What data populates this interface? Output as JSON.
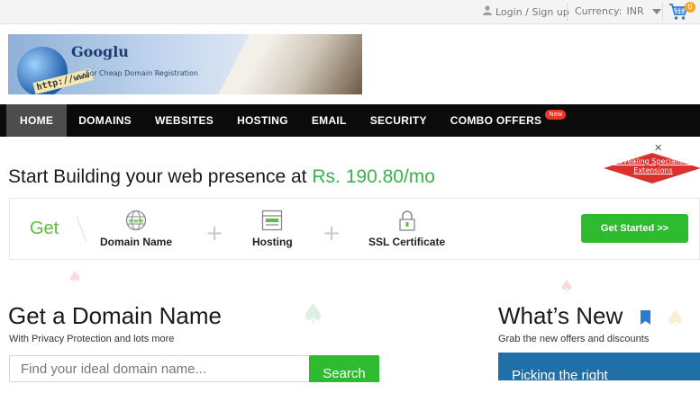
{
  "topbar": {
    "login_label": "Login / Sign up",
    "currency_label": "Currency:",
    "currency_value": "INR",
    "cart_count": "0"
  },
  "banner": {
    "brand": "Googlu",
    "tagline": "For Cheap Domain Registration",
    "url_text": "http://www"
  },
  "nav": {
    "items": [
      {
        "label": "HOME",
        "active": true
      },
      {
        "label": "DOMAINS"
      },
      {
        "label": "WEBSITES"
      },
      {
        "label": "HOSTING"
      },
      {
        "label": "EMAIL"
      },
      {
        "label": "SECURITY"
      },
      {
        "label": "COMBO OFFERS",
        "badge": "New"
      }
    ]
  },
  "ribbon": {
    "label": "Revealing Specialized Extensions"
  },
  "hero": {
    "headline_prefix": "Start Building your web presence at",
    "price": "Rs. 190.80/mo"
  },
  "get_strip": {
    "get_label": "Get",
    "features": [
      {
        "icon": "www-globe-icon",
        "label": "Domain Name"
      },
      {
        "icon": "hosting-window-icon",
        "label": "Hosting"
      },
      {
        "icon": "lock-icon",
        "label": "SSL Certificate"
      }
    ],
    "cta_label": "Get Started >>"
  },
  "domain_section": {
    "title": "Get a Domain Name",
    "subtitle": "With Privacy Protection and lots more",
    "search_placeholder": "Find your ideal domain name...",
    "search_button": "Search"
  },
  "whats_new": {
    "title": "What’s New",
    "subtitle": "Grab the new offers and discounts",
    "promo_text": "Picking the right"
  },
  "colors": {
    "accent_green": "#2fbb2f",
    "price_green": "#38b449",
    "nav_bg": "#0b0b0b",
    "ribbon_red": "#d9322e"
  }
}
